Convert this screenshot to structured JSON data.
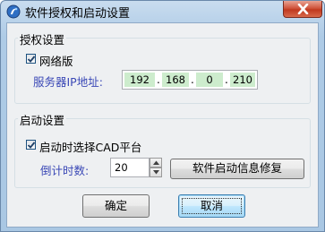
{
  "window": {
    "title": "软件授权和启动设置"
  },
  "license_group": {
    "title": "授权设置",
    "network_checkbox": {
      "label": "网络版",
      "checked": true
    },
    "server_ip_label": "服务器IP地址:",
    "ip_segments": [
      "192",
      "168",
      "0",
      "210"
    ],
    "ip_separator": "."
  },
  "startup_group": {
    "title": "启动设置",
    "select_cad_checkbox": {
      "label": "启动时选择CAD平台",
      "checked": true
    },
    "countdown_label": "倒计时数:",
    "countdown_value": "20",
    "repair_button": "软件启动信息修复"
  },
  "footer": {
    "ok_button": "确定",
    "cancel_button": "取消"
  },
  "colors": {
    "label_blue": "#3a48b6",
    "ip_highlight": "#cdeccd",
    "close_red": "#c0391f"
  },
  "icons": {
    "app": "app-logo-icon",
    "close": "close-icon",
    "check": "checkmark-icon",
    "spin_up": "triangle-up-icon",
    "spin_down": "triangle-down-icon"
  }
}
